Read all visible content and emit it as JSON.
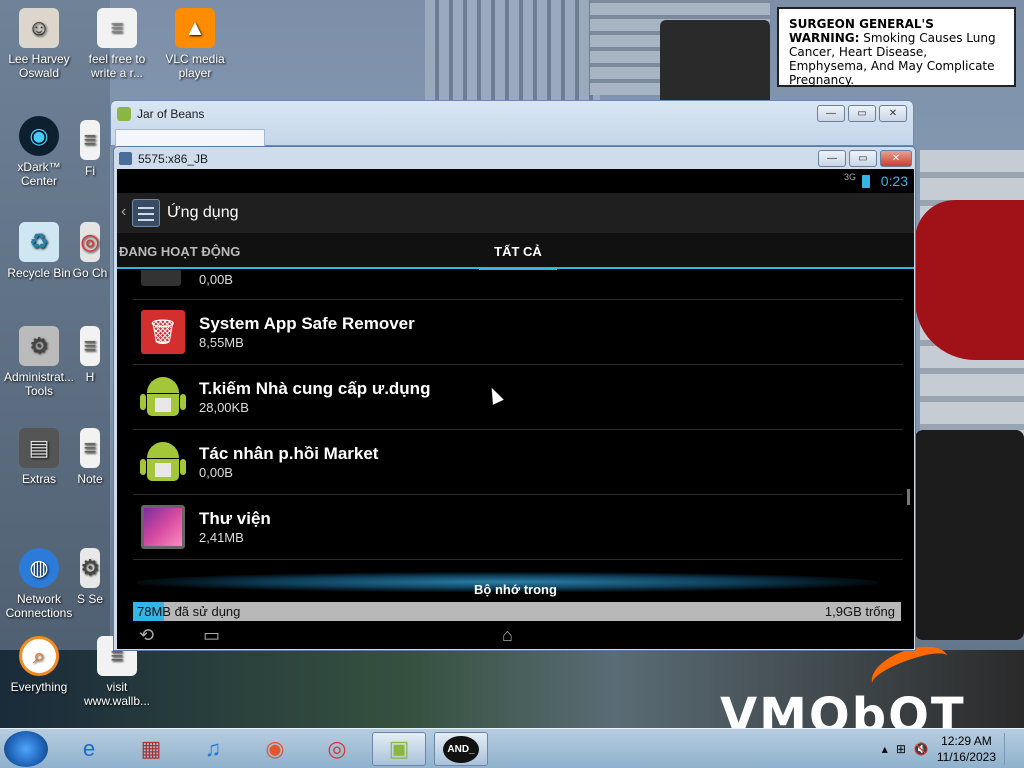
{
  "desktop": {
    "warning_title": "SURGEON GENERAL'S WARNING:",
    "warning_text": "Smoking Causes Lung Cancer, Heart Disease, Emphysema, And May Complicate Pregnancy.",
    "brand": "VMObOT",
    "icons": [
      {
        "label": "Lee Harvey Oswald",
        "icon": "person-icon"
      },
      {
        "label": "feel free to write a r...",
        "icon": "document-icon"
      },
      {
        "label": "VLC media player",
        "icon": "vlc-icon"
      },
      {
        "label": "xDark™ Center",
        "icon": "xdark-icon"
      },
      {
        "label": "Fi",
        "icon": "file-icon"
      },
      {
        "label": "Recycle Bin",
        "icon": "recycle-bin-icon"
      },
      {
        "label": "Go Ch",
        "icon": "chrome-icon"
      },
      {
        "label": "Administrat... Tools",
        "icon": "admin-tools-icon"
      },
      {
        "label": "H",
        "icon": "file-icon"
      },
      {
        "label": "Extras",
        "icon": "folder-icon"
      },
      {
        "label": "Note",
        "icon": "notepad-icon"
      },
      {
        "label": "Network Connections",
        "icon": "network-icon"
      },
      {
        "label": "S Se",
        "icon": "settings-icon"
      },
      {
        "label": "Everything",
        "icon": "search-icon"
      },
      {
        "label": "visit www.wallb...",
        "icon": "link-icon"
      }
    ]
  },
  "outer_window": {
    "title": "Jar of Beans"
  },
  "inner_window": {
    "title": "5575:x86_JB"
  },
  "android": {
    "status_time": "0:23",
    "status_signal": "3G",
    "actionbar_title": "Ứng dụng",
    "tabs": [
      {
        "label": "ĐANG HOẠT ĐỘNG"
      },
      {
        "label": "TẤT CẢ"
      }
    ],
    "apps": [
      {
        "name": "",
        "size": "0,00B",
        "icon": "sd-card-icon"
      },
      {
        "name": "System App Safe Remover",
        "size": "8,55MB",
        "icon": "trash-remove-icon"
      },
      {
        "name": "T.kiếm Nhà cung cấp ư.dụng",
        "size": "28,00KB",
        "icon": "android-icon"
      },
      {
        "name": "Tác nhân p.hồi Market",
        "size": "0,00B",
        "icon": "android-icon"
      },
      {
        "name": "Thư viện",
        "size": "2,41MB",
        "icon": "gallery-icon"
      }
    ],
    "storage": {
      "heading": "Bộ nhớ trong",
      "used": "78MB đã sử dụng",
      "free": "1,9GB trống",
      "used_fraction": 0.04
    },
    "nav": [
      "back",
      "recents",
      "home"
    ]
  },
  "taskbar": {
    "items": [
      {
        "name": "ie-icon",
        "glyph": "e"
      },
      {
        "name": "archive-icon",
        "glyph": "▦"
      },
      {
        "name": "itunes-icon",
        "glyph": "♫"
      },
      {
        "name": "firefox-icon",
        "glyph": "◉"
      },
      {
        "name": "chrome-icon",
        "glyph": "◎"
      },
      {
        "name": "android-sdk-icon",
        "glyph": "▣"
      },
      {
        "name": "terminal-icon",
        "glyph": "AND_"
      }
    ],
    "time": "12:29 AM",
    "date": "11/16/2023"
  }
}
